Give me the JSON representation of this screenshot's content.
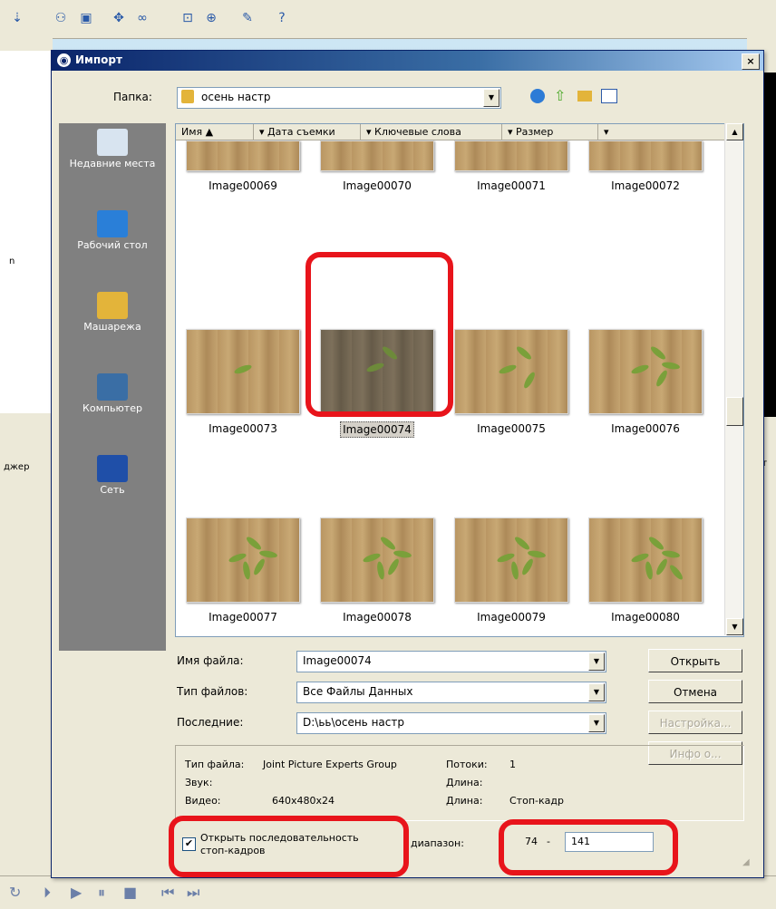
{
  "dialog": {
    "title": "Импорт",
    "close": "×",
    "folder_label": "Папка:",
    "folder_value": "осень настр"
  },
  "places": [
    {
      "label": "Недавние места"
    },
    {
      "label": "Рабочий стол"
    },
    {
      "label": "Машарежа"
    },
    {
      "label": "Компьютер"
    },
    {
      "label": "Сеть"
    }
  ],
  "columns": [
    "Имя",
    "Дата съемки",
    "Ключевые слова",
    "Размер"
  ],
  "files": [
    "Image00069",
    "Image00070",
    "Image00071",
    "Image00072",
    "Image00073",
    "Image00074",
    "Image00075",
    "Image00076",
    "Image00077",
    "Image00078",
    "Image00079",
    "Image00080"
  ],
  "selected_file": "Image00074",
  "form": {
    "filename_label": "Имя файла:",
    "filename_value": "Image00074",
    "filetype_label": "Тип файлов:",
    "filetype_value": "Все Файлы Данных",
    "recent_label": "Последние:",
    "recent_value": "D:\\ьь\\осень настр"
  },
  "buttons": {
    "open": "Открыть",
    "cancel": "Отмена",
    "settings": "Настройка...",
    "info": "Инфо о..."
  },
  "info": {
    "filetype_label": "Тип файла:",
    "filetype_value": "Joint Picture Experts Group",
    "streams_label": "Потоки:",
    "streams_value": "1",
    "sound_label": "Звук:",
    "length_label1": "Длина:",
    "video_label": "Видео:",
    "video_value": "640x480x24",
    "length_label2": "Длина:",
    "length_value": "Стоп-кадр"
  },
  "sequence": {
    "checkbox_label_line1": "Открыть последовательность",
    "checkbox_label_line2": "стоп-кадров",
    "checked": true,
    "range_label": "диапазон:",
    "range_from": "74",
    "range_sep": "-",
    "range_to": "141"
  },
  "background_app": {
    "left_fragment1": "n",
    "left_fragment2": "джер",
    "right_fragment": "ект"
  },
  "colors": {
    "highlight": "#e8141b",
    "title_bar": "#0a246a",
    "places_bg": "#808080"
  }
}
